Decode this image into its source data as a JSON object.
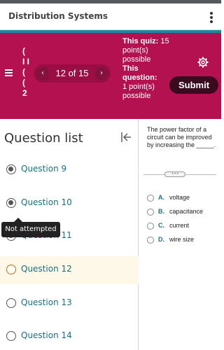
{
  "app": {
    "title": "Distribution Systems"
  },
  "quiz_bar": {
    "quiz_name": "( I I ( ( 2",
    "counter": "12 of 15",
    "this_quiz_label": "This quiz:",
    "this_quiz_value": "15 point(s) possible",
    "this_question_label": "This question:",
    "this_question_value": "1 point(s) possible",
    "submit_label": "Submit",
    "prev_icon": "chevron-left-icon",
    "next_icon": "chevron-right-icon"
  },
  "question_list": {
    "title": "Question list",
    "items": [
      {
        "label": "Question 9",
        "state": "answered"
      },
      {
        "label": "Question 10",
        "state": "answered"
      },
      {
        "label": "Question 11",
        "state": "answered"
      },
      {
        "label": "Question 12",
        "state": "current"
      },
      {
        "label": "Question 13",
        "state": "unanswered"
      },
      {
        "label": "Question 14",
        "state": "unanswered"
      }
    ],
    "tooltip": "Not attempted"
  },
  "question": {
    "text": "The power factor of a circuit can be improved by increasing the _____.",
    "options": [
      {
        "letter": "A.",
        "text": "voltage"
      },
      {
        "letter": "B.",
        "text": "capacitance"
      },
      {
        "letter": "C.",
        "text": "current"
      },
      {
        "letter": "D.",
        "text": "wire size"
      }
    ]
  },
  "colors": {
    "brand_bar": "#b3114f",
    "teal_accent": "#1b8a9a",
    "submit_bg": "#3a0b1e"
  }
}
